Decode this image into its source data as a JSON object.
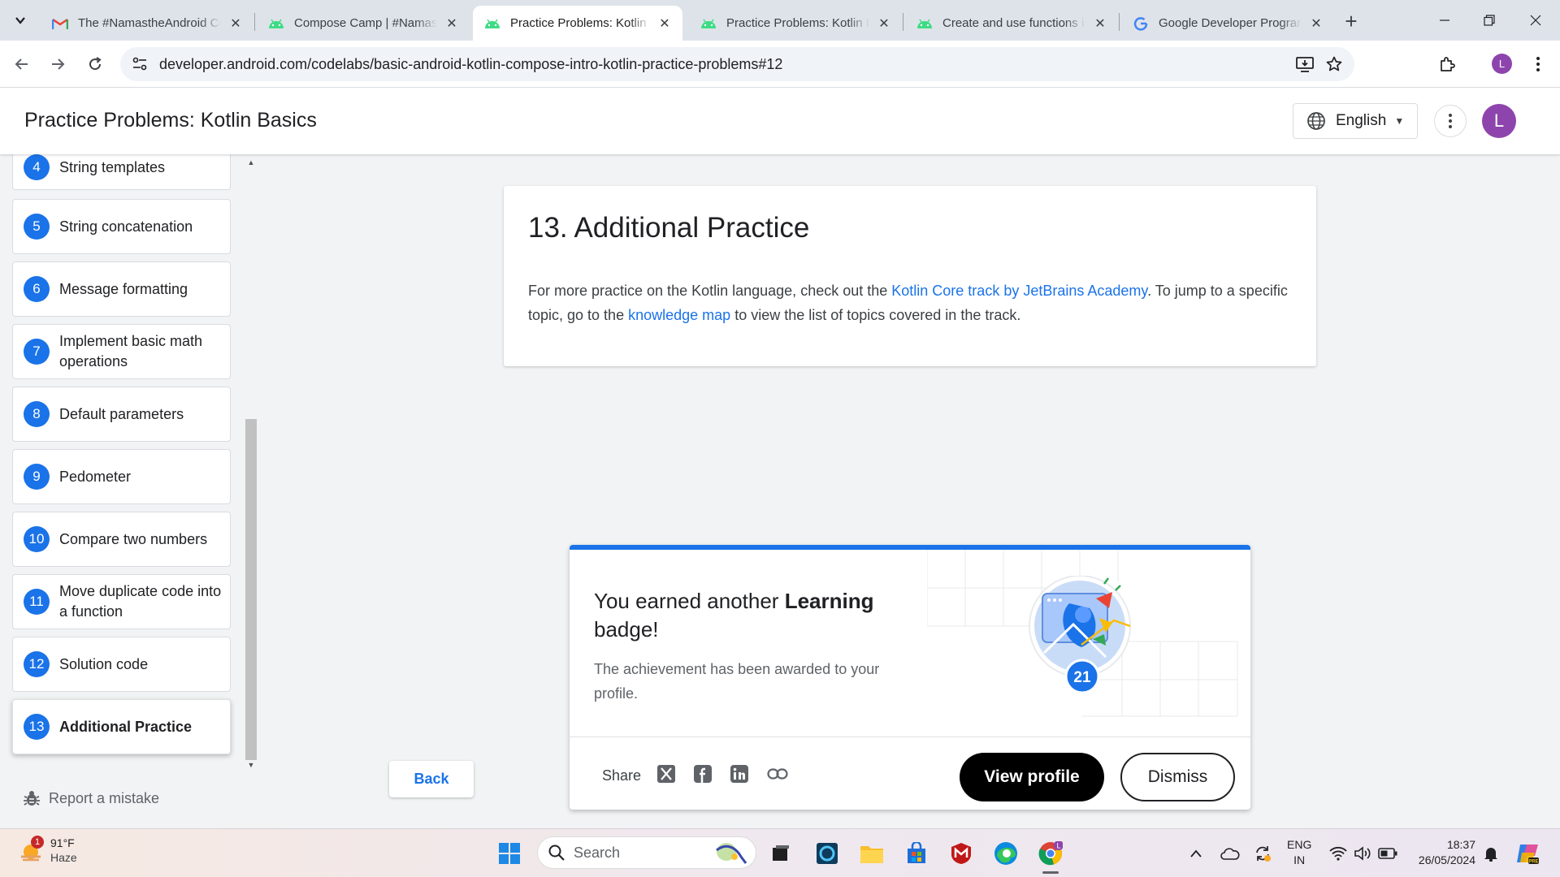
{
  "browser": {
    "tabs": [
      {
        "title": "The #NamastheAndroid Co",
        "favicon": "gmail-icon",
        "active": false
      },
      {
        "title": "Compose Camp | #Namast",
        "favicon": "android-icon",
        "active": false
      },
      {
        "title": "Practice Problems: Kotlin B",
        "favicon": "android-icon",
        "active": true
      },
      {
        "title": "Practice Problems: Kotlin B",
        "favicon": "android-icon",
        "active": false
      },
      {
        "title": "Create and use functions in",
        "favicon": "android-icon",
        "active": false
      },
      {
        "title": "Google Developer Program",
        "favicon": "google-icon",
        "active": false
      }
    ],
    "url": "developer.android.com/codelabs/basic-android-kotlin-compose-intro-kotlin-practice-problems#12",
    "profile_initial": "L"
  },
  "header": {
    "title": "Practice Problems: Kotlin Basics",
    "language": "English",
    "avatar_initial": "L"
  },
  "sidebar": {
    "steps": [
      {
        "num": "4",
        "label": "String templates"
      },
      {
        "num": "5",
        "label": "String concatenation"
      },
      {
        "num": "6",
        "label": "Message formatting"
      },
      {
        "num": "7",
        "label": "Implement basic math operations"
      },
      {
        "num": "8",
        "label": "Default parameters"
      },
      {
        "num": "9",
        "label": "Pedometer"
      },
      {
        "num": "10",
        "label": "Compare two numbers"
      },
      {
        "num": "11",
        "label": "Move duplicate code into a function"
      },
      {
        "num": "12",
        "label": "Solution code"
      },
      {
        "num": "13",
        "label": "Additional Practice"
      }
    ],
    "report_label": "Report a mistake"
  },
  "content": {
    "title": "13. Additional Practice",
    "text_1": "For more practice on the Kotlin language, check out the ",
    "link_1": "Kotlin Core track by JetBrains Academy",
    "text_2": ". To jump to a specific topic, go to the ",
    "link_2": "knowledge map",
    "text_3": " to view the list of topics covered in the track.",
    "back_label": "Back"
  },
  "badge": {
    "heading_prefix": "You earned another ",
    "heading_bold": "Learning",
    "heading_suffix": " badge!",
    "subtext": "The achievement has been awarded to your profile.",
    "count": "21",
    "share_label": "Share",
    "view_profile": "View profile",
    "dismiss": "Dismiss"
  },
  "taskbar": {
    "weather_badge": "1",
    "temperature": "91°F",
    "condition": "Haze",
    "search_placeholder": "Search",
    "lang_line1": "ENG",
    "lang_line2": "IN",
    "time": "18:37",
    "date": "26/05/2024"
  },
  "colors": {
    "accent": "#1a73e8",
    "avatar": "#8e44ad"
  }
}
